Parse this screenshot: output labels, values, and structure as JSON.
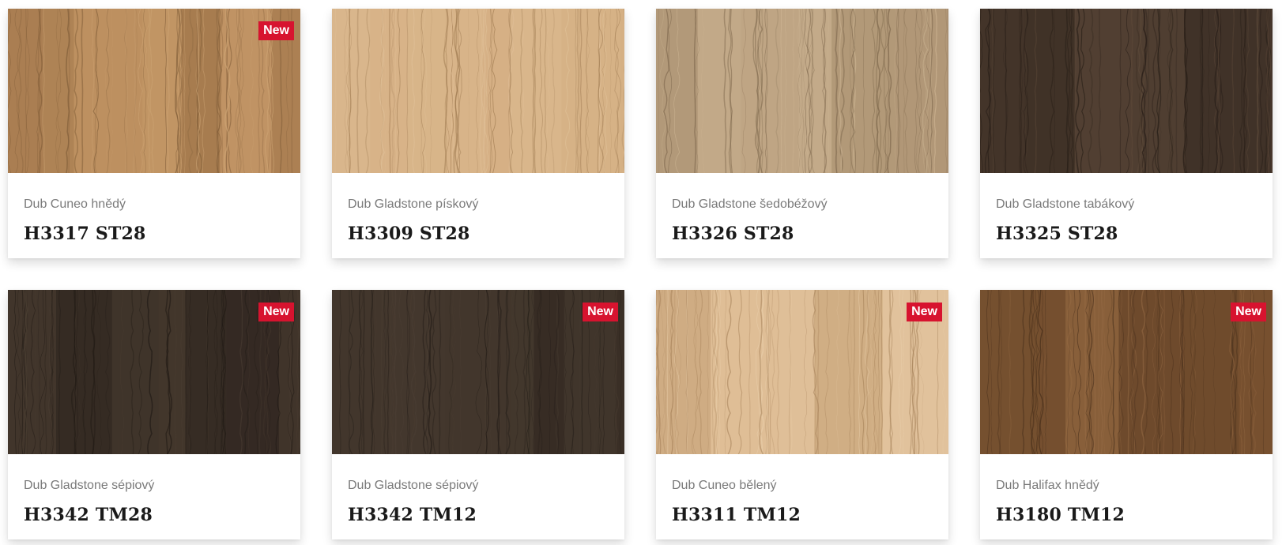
{
  "badge_label": "New",
  "products": [
    {
      "name": "Dub Cuneo hnědý",
      "code": "H3317 ST28",
      "is_new": true,
      "swatch": {
        "base": "#b98c5c",
        "light": "#cfa676",
        "dark": "#8f6840",
        "grain": "#7d5a36"
      }
    },
    {
      "name": "Dub Gladstone pískový",
      "code": "H3309 ST28",
      "is_new": false,
      "swatch": {
        "base": "#d3ad80",
        "light": "#e2c39c",
        "dark": "#b18a5e",
        "grain": "#9c774e"
      }
    },
    {
      "name": "Dub Gladstone šedobéžový",
      "code": "H3326 ST28",
      "is_new": false,
      "swatch": {
        "base": "#bba180",
        "light": "#d2ba98",
        "dark": "#927a5c",
        "grain": "#7c664b"
      }
    },
    {
      "name": "Dub Gladstone tabákový",
      "code": "H3325 ST28",
      "is_new": false,
      "swatch": {
        "base": "#4a3a2e",
        "light": "#5e4a3a",
        "dark": "#2f241c",
        "grain": "#241b15"
      }
    },
    {
      "name": "Dub Gladstone sépiový",
      "code": "H3342 TM28",
      "is_new": true,
      "swatch": {
        "base": "#3c3128",
        "light": "#4c3f33",
        "dark": "#2a221c",
        "grain": "#1f1914"
      }
    },
    {
      "name": "Dub Gladstone sépiový",
      "code": "H3342 TM12",
      "is_new": true,
      "swatch": {
        "base": "#3d3229",
        "light": "#4b3e33",
        "dark": "#2b231d",
        "grain": "#201a15"
      }
    },
    {
      "name": "Dub Cuneo bělený",
      "code": "H3311 TM12",
      "is_new": true,
      "swatch": {
        "base": "#dcbb92",
        "light": "#ebd1ae",
        "dark": "#bf9a70",
        "grain": "#a47f57"
      }
    },
    {
      "name": "Dub Halifax hnědý",
      "code": "H3180 TM12",
      "is_new": true,
      "swatch": {
        "base": "#7e5633",
        "light": "#9a6e47",
        "dark": "#573a22",
        "grain": "#442c19"
      }
    }
  ]
}
